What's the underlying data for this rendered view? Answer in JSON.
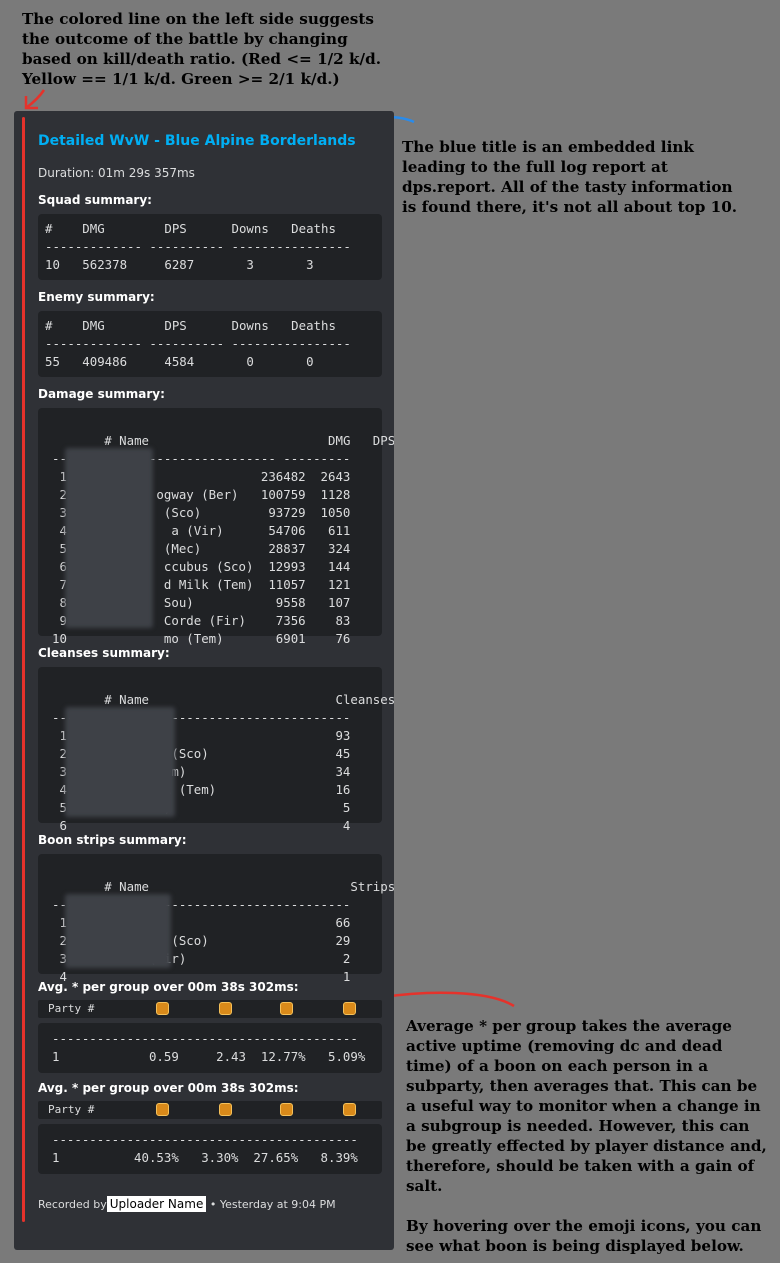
{
  "notes": {
    "top": "The colored line on the left side suggests the outcome of the battle by changing based on kill/death ratio. (Red <= 1/2 k/d. Yellow == 1/1 k/d. Green >= 2/1 k/d.)",
    "right": "The blue title is an embedded link leading to the full log report at dps.report. All of the tasty information is found there, it's not all about top 10.",
    "bottom": "Average * per group takes the average active uptime (removing dc and dead time) of a boon on each person in a subparty, then averages that. This can be a useful way to monitor when a change in a subgroup is needed. However, this can be greatly effected by player distance and, therefore, should be taken with a gain of salt.\n\nBy hovering over the emoji icons, you can see what boon is being displayed below."
  },
  "embed": {
    "title": "Detailed WvW - Blue Alpine Borderlands",
    "duration": "Duration: 01m 29s 357ms",
    "bar_color": "#e5322b",
    "squad_title": "Squad summary:",
    "squad_code": "#    DMG        DPS      Downs   Deaths\n------------- ---------- ----------------\n10   562378     6287       3       3",
    "enemy_title": "Enemy summary:",
    "enemy_code": "#    DMG        DPS      Downs   Deaths\n------------- ---------- ----------------\n55   409486     4584       0       0",
    "damage_title": "Damage summary:",
    "damage_code": " # Name                        DMG   DPS\n------------------------------ ---------\n 1                          236482  2643\n 2            ogway (Ber)   100759  1128\n 3             (Sco)         93729  1050\n 4              a (Vir)      54706   611\n 5             (Mec)         28837   324\n 6             ccubus (Sco)  12993   144\n 7             d Milk (Tem)  11057   121\n 8             Sou)           9558   107\n 9             Corde (Fir)    7356    83\n10             mo (Tem)       6901    76",
    "cleanses_title": "Cleanses summary:",
    "cleanses_code": " # Name                         Cleanses\n----------------------------------------\n 1           o)                       93\n 2           us (Sco)                 45\n 3           (Tem)                    34\n 4           ilk (Tem)                16\n 5           ec)                       5\n 6                                     4",
    "strips_title": "Boon strips summary:",
    "strips_code": " # Name                           Strips\n----------------------------------------\n 1           o)                       66\n 2           us (Sco)                 29\n 3           (Vir)                     2\n 4                                     1",
    "avg1_title": "Avg. * per group over 00m 38s 302ms:",
    "avg1_header": "Party #",
    "avg1_code": "-----------------------------------------\n1            0.59     2.43  12.77%   5.09%",
    "avg2_title": "Avg. * per group over 00m 38s 302ms:",
    "avg2_header": "Party #",
    "avg2_code": "-----------------------------------------\n1          40.53%   3.30%  27.65%   8.39%",
    "footer_prefix": "Recorded by",
    "uploader": "Uploader Name",
    "footer_suffix": " • Yesterday at 9:04 PM"
  }
}
